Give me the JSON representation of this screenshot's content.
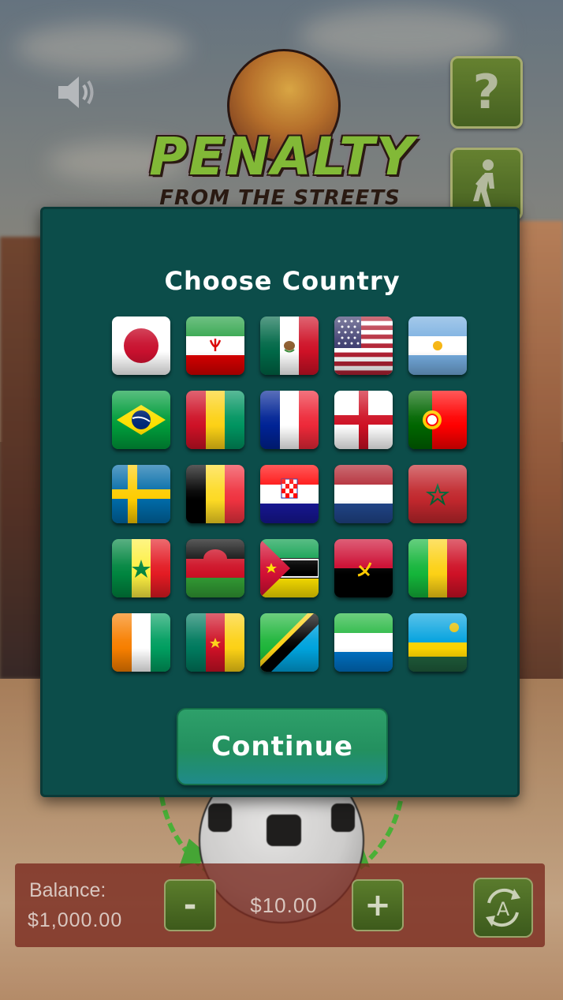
{
  "game": {
    "logo_title": "PENALTY",
    "logo_subtitle": "FROM THE STREETS"
  },
  "controls": {
    "help_label": "?",
    "sound_icon": "speaker-icon",
    "walk_icon": "walking-person-icon"
  },
  "modal": {
    "title": "Choose Country",
    "continue_label": "Continue",
    "flags": [
      "japan",
      "iran",
      "mexico",
      "usa",
      "argentina",
      "brazil",
      "guinea",
      "france",
      "england",
      "portugal",
      "sweden",
      "belgium",
      "croatia",
      "netherlands",
      "morocco",
      "senegal",
      "malawi",
      "mozambique",
      "angola",
      "mali",
      "ivory-coast",
      "cameroon",
      "tanzania",
      "sierra-leone",
      "rwanda"
    ]
  },
  "bottom_bar": {
    "balance_label": "Balance:",
    "balance_value": "$1,000.00",
    "minus_label": "-",
    "bet_value": "$10.00",
    "plus_label": "+",
    "auto_icon": "autoplay-icon"
  },
  "colors": {
    "modal_bg": "#0c4d4a",
    "continue_button": "#2ea06a",
    "game_button": "#4a6a22"
  }
}
